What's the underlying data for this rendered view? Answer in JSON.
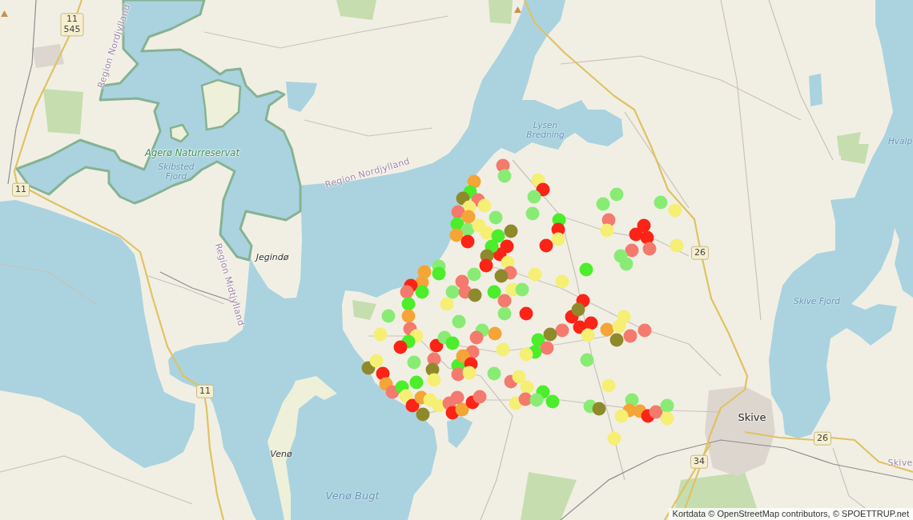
{
  "map": {
    "labels": [
      {
        "kind": "region",
        "text": "Region Nordjylland"
      },
      {
        "kind": "water",
        "text": "Lysen Bredning"
      },
      {
        "kind": "water",
        "text": "Hvalp"
      },
      {
        "kind": "nature",
        "text": "Agerø Naturreservat"
      },
      {
        "kind": "water",
        "text": "Skibsted Fjord"
      },
      {
        "kind": "region",
        "text": "Region Nordjylland"
      },
      {
        "kind": "place",
        "text": "Jegindø"
      },
      {
        "kind": "region",
        "text": "Region Midtjylland"
      },
      {
        "kind": "water",
        "text": "Skive Fjord"
      },
      {
        "kind": "town",
        "text": "Skive"
      },
      {
        "kind": "place",
        "text": "Venø"
      },
      {
        "kind": "region",
        "text": "Skive"
      },
      {
        "kind": "water",
        "text": "Venø Bugt"
      }
    ],
    "shields": [
      {
        "lines": [
          "11",
          "545"
        ]
      },
      {
        "lines": [
          "11"
        ]
      },
      {
        "lines": [
          "26"
        ]
      },
      {
        "lines": [
          "11"
        ]
      },
      {
        "lines": [
          "26"
        ]
      },
      {
        "lines": [
          "34"
        ]
      }
    ],
    "markers": [
      {
        "color": "#f47a6e"
      },
      {
        "color": "#88ec74"
      },
      {
        "color": "#f5a436"
      },
      {
        "color": "#4ced2a"
      },
      {
        "color": "#8e8a2c"
      },
      {
        "color": "#f47a6e"
      },
      {
        "color": "#f5ef74"
      },
      {
        "color": "#f5ef74"
      },
      {
        "color": "#f47a6e"
      },
      {
        "color": "#f5a436"
      },
      {
        "color": "#4ced2a"
      },
      {
        "color": "#88ec74"
      },
      {
        "color": "#f5ef74"
      },
      {
        "color": "#f5a436"
      },
      {
        "color": "#fb2416"
      },
      {
        "color": "#88ec74"
      },
      {
        "color": "#8e8a2c"
      },
      {
        "color": "#f5ef74"
      },
      {
        "color": "#4ced2a"
      },
      {
        "color": "#fb2416"
      },
      {
        "color": "#fb2416"
      },
      {
        "color": "#4ced2a"
      },
      {
        "color": "#8e8a2c"
      },
      {
        "color": "#f5ef74"
      },
      {
        "color": "#fb2416"
      },
      {
        "color": "#f47a6e"
      },
      {
        "color": "#8e8a2c"
      },
      {
        "color": "#88ec74"
      },
      {
        "color": "#f47a6e"
      },
      {
        "color": "#88ec74"
      },
      {
        "color": "#4ced2a"
      },
      {
        "color": "#f5a436"
      },
      {
        "color": "#f5a436"
      },
      {
        "color": "#fb2416"
      },
      {
        "color": "#4ced2a"
      },
      {
        "color": "#f47a6e"
      },
      {
        "color": "#88ec74"
      },
      {
        "color": "#f47a6e"
      },
      {
        "color": "#8e8a2c"
      },
      {
        "color": "#4ced2a"
      },
      {
        "color": "#f5ef74"
      },
      {
        "color": "#88ec74"
      },
      {
        "color": "#4ced2a"
      },
      {
        "color": "#f5ef74"
      },
      {
        "color": "#f47a6e"
      },
      {
        "color": "#fb2416"
      },
      {
        "color": "#88ec74"
      },
      {
        "color": "#88ec74"
      },
      {
        "color": "#f5a436"
      },
      {
        "color": "#88ec74"
      },
      {
        "color": "#88ec74"
      },
      {
        "color": "#f5a436"
      },
      {
        "color": "#f47a6e"
      },
      {
        "color": "#f47a6e"
      },
      {
        "color": "#f5ef74"
      },
      {
        "color": "#f5ef74"
      },
      {
        "color": "#4ced2a"
      },
      {
        "color": "#fb2416"
      },
      {
        "color": "#fb2416"
      },
      {
        "color": "#88ec74"
      },
      {
        "color": "#4ced2a"
      },
      {
        "color": "#f5ef74"
      },
      {
        "color": "#88ec74"
      },
      {
        "color": "#f47a6e"
      },
      {
        "color": "#8e8a2c"
      },
      {
        "color": "#f47a6e"
      },
      {
        "color": "#4ced2a"
      },
      {
        "color": "#f5a436"
      },
      {
        "color": "#fb2416"
      },
      {
        "color": "#f5ef74"
      },
      {
        "color": "#f47a6e"
      },
      {
        "color": "#f5ef74"
      },
      {
        "color": "#88ec74"
      },
      {
        "color": "#f47a6e"
      },
      {
        "color": "#f5ef74"
      },
      {
        "color": "#f5ef74"
      },
      {
        "color": "#8e8a2c"
      },
      {
        "color": "#f5ef74"
      },
      {
        "color": "#fb2416"
      },
      {
        "color": "#f5a436"
      },
      {
        "color": "#f47a6e"
      },
      {
        "color": "#4ced2a"
      },
      {
        "color": "#4ced2a"
      },
      {
        "color": "#f5ef74"
      },
      {
        "color": "#fb2416"
      },
      {
        "color": "#f5a436"
      },
      {
        "color": "#f5ef74"
      },
      {
        "color": "#8e8a2c"
      },
      {
        "color": "#f5ef74"
      },
      {
        "color": "#f47a6e"
      },
      {
        "color": "#fb2416"
      },
      {
        "color": "#f5a436"
      },
      {
        "color": "#f47a6e"
      },
      {
        "color": "#fb2416"
      },
      {
        "color": "#f47a6e"
      },
      {
        "color": "#f5ef74"
      },
      {
        "color": "#f47a6e"
      },
      {
        "color": "#f5ef74"
      },
      {
        "color": "#fb2416"
      },
      {
        "color": "#88ec74"
      },
      {
        "color": "#88ec74"
      },
      {
        "color": "#4ced2a"
      },
      {
        "color": "#fb2416"
      },
      {
        "color": "#f5ef74"
      },
      {
        "color": "#fb2416"
      },
      {
        "color": "#88ec74"
      },
      {
        "color": "#88ec74"
      },
      {
        "color": "#88ec74"
      },
      {
        "color": "#f5ef74"
      },
      {
        "color": "#f47a6e"
      },
      {
        "color": "#f5ef74"
      },
      {
        "color": "#fb2416"
      },
      {
        "color": "#fb2416"
      },
      {
        "color": "#fb2416"
      },
      {
        "color": "#f47a6e"
      },
      {
        "color": "#f47a6e"
      },
      {
        "color": "#88ec74"
      },
      {
        "color": "#88ec74"
      },
      {
        "color": "#4ced2a"
      },
      {
        "color": "#f5ef74"
      },
      {
        "color": "#f5ef74"
      },
      {
        "color": "#f5ef74"
      },
      {
        "color": "#fb2416"
      },
      {
        "color": "#fb2416"
      },
      {
        "color": "#fb2416"
      },
      {
        "color": "#fb2416"
      },
      {
        "color": "#8e8a2c"
      },
      {
        "color": "#f5ef74"
      },
      {
        "color": "#f47a6e"
      },
      {
        "color": "#8e8a2c"
      },
      {
        "color": "#4ced2a"
      },
      {
        "color": "#f47a6e"
      },
      {
        "color": "#4ced2a"
      },
      {
        "color": "#f5ef74"
      },
      {
        "color": "#f5a436"
      },
      {
        "color": "#f5ef74"
      },
      {
        "color": "#f5ef74"
      },
      {
        "color": "#8e8a2c"
      },
      {
        "color": "#f47a6e"
      },
      {
        "color": "#f47a6e"
      },
      {
        "color": "#88ec74"
      },
      {
        "color": "#f5ef74"
      },
      {
        "color": "#4ced2a"
      },
      {
        "color": "#4ced2a"
      },
      {
        "color": "#88ec74"
      },
      {
        "color": "#88ec74"
      },
      {
        "color": "#8e8a2c"
      },
      {
        "color": "#88ec74"
      },
      {
        "color": "#f5a436"
      },
      {
        "color": "#f5ef74"
      },
      {
        "color": "#f5a436"
      },
      {
        "color": "#fb2416"
      },
      {
        "color": "#f47a6e"
      },
      {
        "color": "#88ec74"
      },
      {
        "color": "#f5ef74"
      },
      {
        "color": "#f5ef74"
      }
    ]
  },
  "attribution": "Kortdata © OpenStreetMap contributors, © SPOETTRUP.net"
}
